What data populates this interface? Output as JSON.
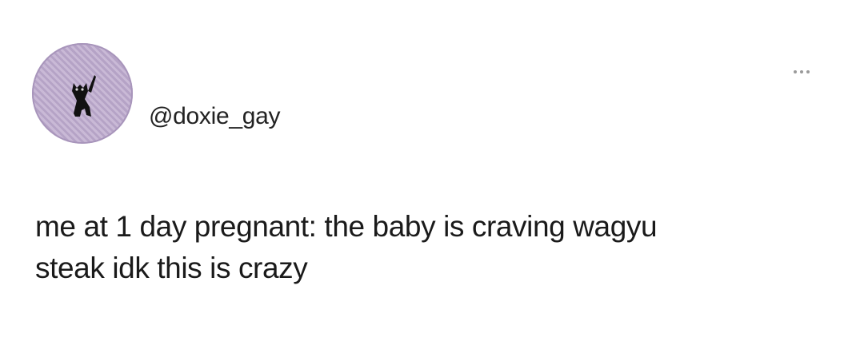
{
  "tweet": {
    "handle": "@doxie_gay",
    "text_line_1": "me at 1 day pregnant: the baby is craving wagyu",
    "text_line_2": "steak idk this is crazy",
    "more_icon": "more-horizontal-icon"
  },
  "colors": {
    "background": "#ffffff",
    "text": "#1a1a1a",
    "avatar_bg": "#c9b9d6"
  }
}
